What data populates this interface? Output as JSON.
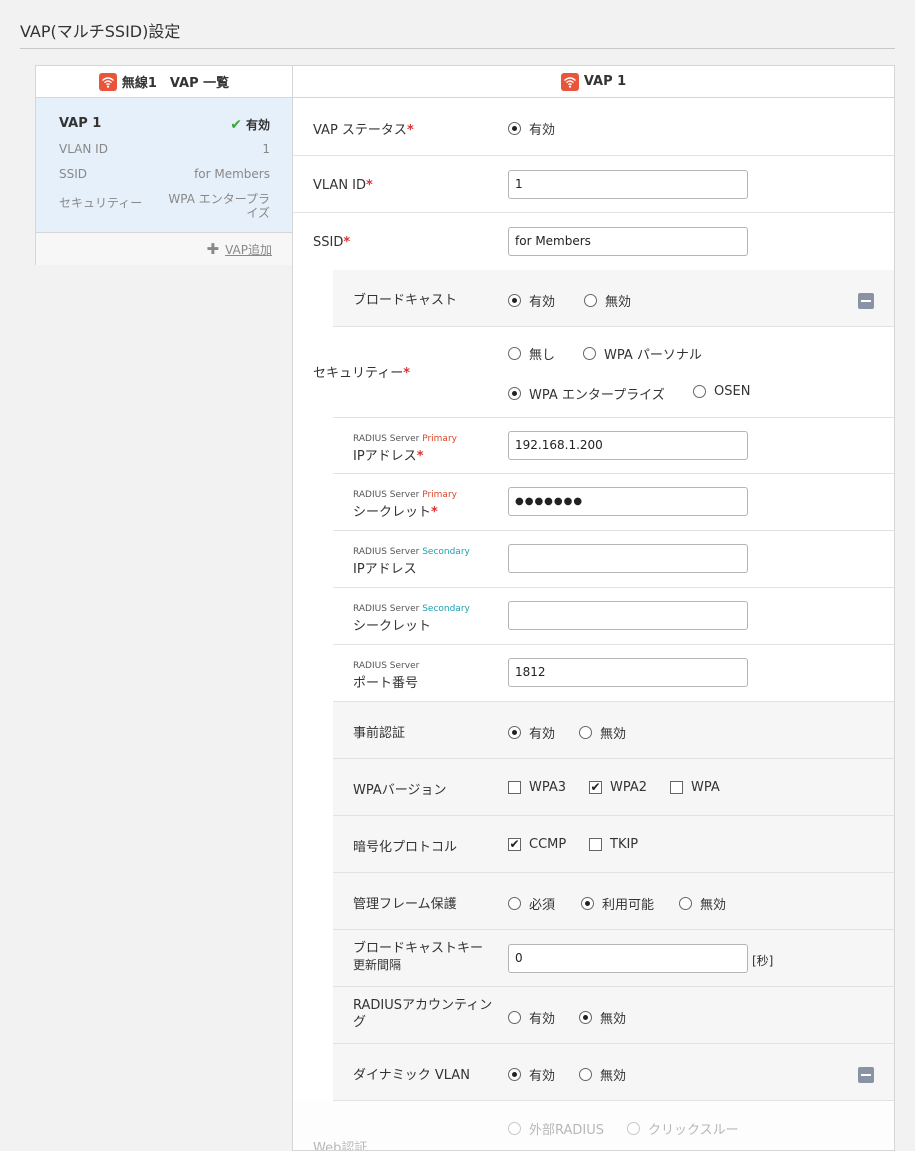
{
  "page": {
    "title": "VAP(マルチSSID)設定"
  },
  "colors": {
    "wifi_badge": "#e8553a",
    "active_check": "#3aa63a",
    "required": "#d33333",
    "primary_tag": "#d9482b",
    "secondary_tag": "#1ea0b0"
  },
  "left_panel": {
    "header": "無線1　VAP 一覧",
    "icon": "wifi-icon",
    "vap": {
      "name": "VAP 1",
      "status": "有効",
      "rows": [
        {
          "label": "VLAN ID",
          "value": "1"
        },
        {
          "label": "SSID",
          "value": "for Members"
        },
        {
          "label": "セキュリティー",
          "value": "WPA エンタープライズ"
        }
      ]
    },
    "add_label": "VAP追加"
  },
  "right_panel": {
    "header": "VAP 1",
    "vap_status": {
      "label": "VAP ステータス",
      "options": [
        "有効"
      ],
      "selected": "有効"
    },
    "vlan_id": {
      "label": "VLAN ID",
      "value": "1"
    },
    "ssid": {
      "label": "SSID",
      "value": "for Members"
    },
    "broadcast": {
      "label": "ブロードキャスト",
      "options": [
        "有効",
        "無効"
      ],
      "selected": "有効"
    },
    "security": {
      "label": "セキュリティー",
      "options": [
        "無し",
        "WPA パーソナル",
        "WPA エンタープライズ",
        "OSEN"
      ],
      "selected": "WPA エンタープライズ"
    },
    "radius_primary_ip": {
      "tag_prefix": "RADIUS Server",
      "tag": "Primary",
      "label": "IPアドレス",
      "value": "192.168.1.200"
    },
    "radius_primary_secret": {
      "tag_prefix": "RADIUS Server",
      "tag": "Primary",
      "label": "シークレット",
      "value": "●●●●●●●"
    },
    "radius_secondary_ip": {
      "tag_prefix": "RADIUS Server",
      "tag": "Secondary",
      "label": "IPアドレス",
      "value": ""
    },
    "radius_secondary_secret": {
      "tag_prefix": "RADIUS Server",
      "tag": "Secondary",
      "label": "シークレット",
      "value": ""
    },
    "radius_port": {
      "tag_prefix": "RADIUS Server",
      "label": "ポート番号",
      "value": "1812"
    },
    "preauth": {
      "label": "事前認証",
      "options": [
        "有効",
        "無効"
      ],
      "selected": "有効"
    },
    "wpa_version": {
      "label": "WPAバージョン",
      "options": [
        "WPA3",
        "WPA2",
        "WPA"
      ],
      "checked": [
        "WPA2"
      ]
    },
    "encryption": {
      "label": "暗号化プロトコル",
      "options": [
        "CCMP",
        "TKIP"
      ],
      "checked": [
        "CCMP"
      ]
    },
    "mgmt_frame": {
      "label": "管理フレーム保護",
      "options": [
        "必須",
        "利用可能",
        "無効"
      ],
      "selected": "利用可能"
    },
    "broadcast_key": {
      "label_line1": "ブロードキャストキー",
      "label_line2": "更新間隔",
      "value": "0",
      "unit": "[秒]"
    },
    "radius_accounting": {
      "label_line1": "RADIUSアカウンティン",
      "label_line2": "グ",
      "options": [
        "有効",
        "無効"
      ],
      "selected": "無効"
    },
    "dynamic_vlan": {
      "label": "ダイナミック VLAN",
      "options": [
        "有効",
        "無効"
      ],
      "selected": "有効"
    },
    "web_auth": {
      "label": "Web認証",
      "options": [
        "外部RADIUS",
        "クリックスルー"
      ]
    }
  }
}
